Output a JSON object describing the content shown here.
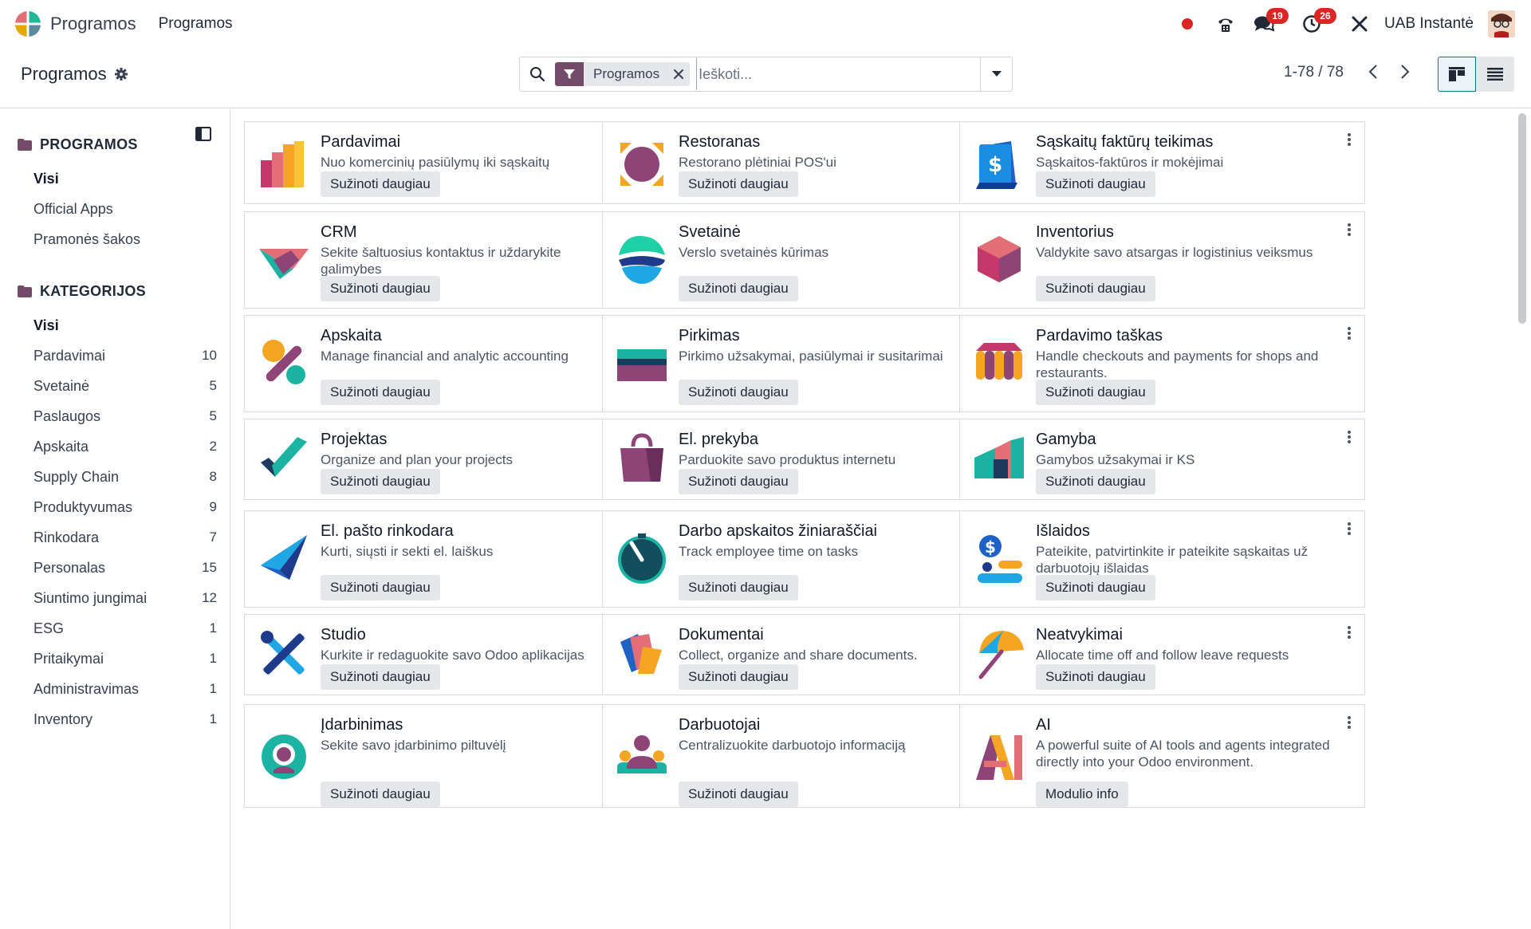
{
  "navbar": {
    "app_name": "Programos",
    "menu_item": "Programos",
    "messages_badge": "19",
    "activities_badge": "26",
    "company": "UAB Instantė"
  },
  "control_panel": {
    "breadcrumb": "Programos",
    "facet_label": "Programos",
    "search_placeholder": "Ieškoti...",
    "pager": "1-78 / 78"
  },
  "sidebar": {
    "section1_title": "PROGRAMOS",
    "section1_items": [
      {
        "label": "Visi",
        "active": true
      },
      {
        "label": "Official Apps"
      },
      {
        "label": "Pramonės šakos"
      }
    ],
    "section2_title": "KATEGORIJOS",
    "section2_items": [
      {
        "label": "Visi",
        "active": true,
        "count": ""
      },
      {
        "label": "Pardavimai",
        "count": "10"
      },
      {
        "label": "Svetainė",
        "count": "5"
      },
      {
        "label": "Paslaugos",
        "count": "5"
      },
      {
        "label": "Apskaita",
        "count": "2"
      },
      {
        "label": "Supply Chain",
        "count": "8"
      },
      {
        "label": "Produktyvumas",
        "count": "9"
      },
      {
        "label": "Rinkodara",
        "count": "7"
      },
      {
        "label": "Personalas",
        "count": "15"
      },
      {
        "label": "Siuntimo jungimai",
        "count": "12"
      },
      {
        "label": "ESG",
        "count": "1"
      },
      {
        "label": "Pritaikymai",
        "count": "1"
      },
      {
        "label": "Administravimas",
        "count": "1"
      },
      {
        "label": "Inventory",
        "count": "1"
      }
    ]
  },
  "apps": [
    {
      "title": "Pardavimai",
      "desc": "Nuo komercinių pasiūlymų iki sąskaitų",
      "button": "Sužinoti daugiau",
      "icon": "sales-icon"
    },
    {
      "title": "Restoranas",
      "desc": "Restorano plėtiniai POS'ui",
      "button": "Sužinoti daugiau",
      "icon": "restaurant-icon"
    },
    {
      "title": "Sąskaitų faktūrų teikimas",
      "desc": "Sąskaitos-faktūros ir mokėjimai",
      "button": "Sužinoti daugiau",
      "icon": "invoicing-icon"
    },
    {
      "title": "CRM",
      "desc": "Sekite šaltuosius kontaktus ir uždarykite galimybes",
      "button": "Sužinoti daugiau",
      "icon": "crm-icon"
    },
    {
      "title": "Svetainė",
      "desc": "Verslo svetainės kūrimas",
      "button": "Sužinoti daugiau",
      "icon": "website-icon"
    },
    {
      "title": "Inventorius",
      "desc": "Valdykite savo atsargas ir logistinius veiksmus",
      "button": "Sužinoti daugiau",
      "icon": "inventory-icon"
    },
    {
      "title": "Apskaita",
      "desc": "Manage financial and analytic accounting",
      "button": "Sužinoti daugiau",
      "icon": "accounting-icon"
    },
    {
      "title": "Pirkimas",
      "desc": "Pirkimo užsakymai, pasiūlymai ir susitarimai",
      "button": "Sužinoti daugiau",
      "icon": "purchase-icon"
    },
    {
      "title": "Pardavimo taškas",
      "desc": "Handle checkouts and payments for shops and restaurants.",
      "button": "Sužinoti daugiau",
      "icon": "pos-icon"
    },
    {
      "title": "Projektas",
      "desc": "Organize and plan your projects",
      "button": "Sužinoti daugiau",
      "icon": "project-icon"
    },
    {
      "title": "El. prekyba",
      "desc": "Parduokite savo produktus internetu",
      "button": "Sužinoti daugiau",
      "icon": "ecommerce-icon"
    },
    {
      "title": "Gamyba",
      "desc": "Gamybos užsakymai ir KS",
      "button": "Sužinoti daugiau",
      "icon": "manufacturing-icon"
    },
    {
      "title": "El. pašto rinkodara",
      "desc": "Kurti, siųsti ir sekti el. laiškus",
      "button": "Sužinoti daugiau",
      "icon": "email-marketing-icon"
    },
    {
      "title": "Darbo apskaitos žiniaraščiai",
      "desc": "Track employee time on tasks",
      "button": "Sužinoti daugiau",
      "icon": "timesheets-icon"
    },
    {
      "title": "Išlaidos",
      "desc": "Pateikite, patvirtinkite ir pateikite sąskaitas už darbuotojų išlaidas",
      "button": "Sužinoti daugiau",
      "icon": "expenses-icon"
    },
    {
      "title": "Studio",
      "desc": "Kurkite ir redaguokite savo Odoo aplikacijas",
      "button": "Sužinoti daugiau",
      "icon": "studio-icon"
    },
    {
      "title": "Dokumentai",
      "desc": "Collect, organize and share documents.",
      "button": "Sužinoti daugiau",
      "icon": "documents-icon"
    },
    {
      "title": "Neatvykimai",
      "desc": "Allocate time off and follow leave requests",
      "button": "Sužinoti daugiau",
      "icon": "time-off-icon"
    },
    {
      "title": "Įdarbinimas",
      "desc": "Sekite savo įdarbinimo piltuvėlį",
      "button": "Sužinoti daugiau",
      "icon": "recruitment-icon"
    },
    {
      "title": "Darbuotojai",
      "desc": "Centralizuokite darbuotojo informaciją",
      "button": "Sužinoti daugiau",
      "icon": "employees-icon"
    },
    {
      "title": "AI",
      "desc": "A powerful suite of AI tools and agents integrated directly into your Odoo environment.",
      "button": "Modulio info",
      "icon": "ai-icon"
    }
  ],
  "colors": {
    "brand": "#714b67",
    "active_view": "#0e7490",
    "badge": "#dc2626"
  }
}
